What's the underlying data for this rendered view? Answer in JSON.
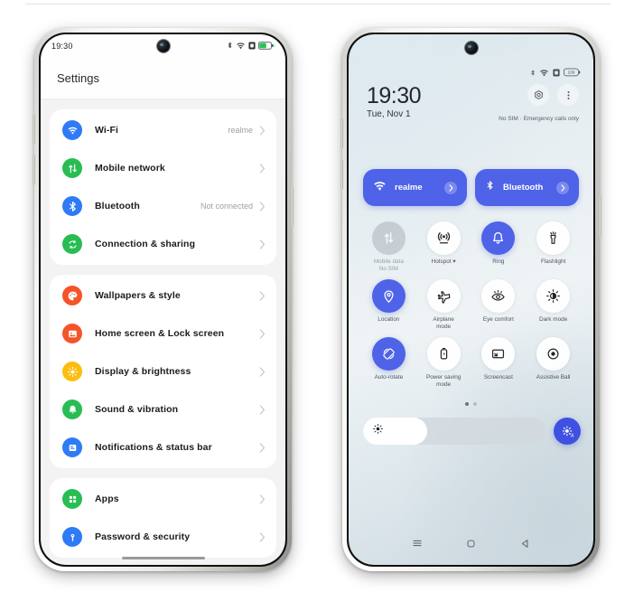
{
  "phone_settings": {
    "status_bar": {
      "time": "19:30",
      "icons": [
        "bluetooth-icon",
        "wifi-icon",
        "sim-card-icon",
        "battery-charging-icon"
      ]
    },
    "header_title": "Settings",
    "groups": [
      {
        "items": [
          {
            "label": "Wi-Fi",
            "value": "realme",
            "icon": "wifi-icon",
            "color": "#2f7bf6"
          },
          {
            "label": "Mobile network",
            "value": "",
            "icon": "mobile-network-icon",
            "color": "#28bd52"
          },
          {
            "label": "Bluetooth",
            "value": "Not connected",
            "icon": "bluetooth-icon",
            "color": "#2f7bf6"
          },
          {
            "label": "Connection & sharing",
            "value": "",
            "icon": "connection-sharing-icon",
            "color": "#28bd52"
          }
        ]
      },
      {
        "items": [
          {
            "label": "Wallpapers & style",
            "value": "",
            "icon": "wallpapers-icon",
            "color": "#f4542a"
          },
          {
            "label": "Home screen & Lock screen",
            "value": "",
            "icon": "home-lock-screen-icon",
            "color": "#f4542a"
          },
          {
            "label": "Display & brightness",
            "value": "",
            "icon": "display-brightness-icon",
            "color": "#fbbd10"
          },
          {
            "label": "Sound & vibration",
            "value": "",
            "icon": "sound-vibration-icon",
            "color": "#28bd52"
          },
          {
            "label": "Notifications & status bar",
            "value": "",
            "icon": "notifications-icon",
            "color": "#2f7bf6"
          }
        ]
      },
      {
        "items": [
          {
            "label": "Apps",
            "value": "",
            "icon": "apps-icon",
            "color": "#28bd52"
          },
          {
            "label": "Password & security",
            "value": "",
            "icon": "password-security-icon",
            "color": "#2f7bf6"
          }
        ]
      }
    ]
  },
  "phone_control_center": {
    "status_bar": {
      "icons": [
        "bluetooth-icon",
        "wifi-icon",
        "sim-card-icon",
        "battery-100-icon"
      ]
    },
    "clock": "19:30",
    "date": "Tue, Nov 1",
    "sim_status": "No SIM · Emergency calls only",
    "header_buttons": [
      "settings-gear-icon",
      "more-options-icon"
    ],
    "big_tiles": [
      {
        "label": "realme",
        "icon": "wifi-icon",
        "state": "on"
      },
      {
        "label": "Bluetooth",
        "icon": "bluetooth-icon",
        "state": "on"
      }
    ],
    "tiles": [
      {
        "label": "Mobile data\nNo SIM",
        "icon": "mobile-data-icon",
        "state": "disabled"
      },
      {
        "label": "Hotspot ▾",
        "icon": "hotspot-icon",
        "state": "off"
      },
      {
        "label": "Ring",
        "icon": "ring-bell-icon",
        "state": "on"
      },
      {
        "label": "Flashlight",
        "icon": "flashlight-icon",
        "state": "off"
      },
      {
        "label": "Location",
        "icon": "location-pin-icon",
        "state": "on"
      },
      {
        "label": "Airplane\nmode",
        "icon": "airplane-icon",
        "state": "off"
      },
      {
        "label": "Eye comfort",
        "icon": "eye-comfort-icon",
        "state": "off"
      },
      {
        "label": "Dark mode",
        "icon": "dark-mode-icon",
        "state": "off"
      },
      {
        "label": "Auto-rotate",
        "icon": "auto-rotate-icon",
        "state": "on"
      },
      {
        "label": "Power saving\nmode",
        "icon": "power-saving-icon",
        "state": "off"
      },
      {
        "label": "Screencast",
        "icon": "screencast-icon",
        "state": "off"
      },
      {
        "label": "Assistive Ball",
        "icon": "assistive-ball-icon",
        "state": "off"
      }
    ],
    "page_dots": {
      "count": 2,
      "active": 0
    },
    "brightness": {
      "value_percent": 35,
      "icon": "brightness-sun-icon",
      "auto_icon": "auto-brightness-icon"
    },
    "nav_bar": [
      "recents-icon",
      "home-icon",
      "back-icon"
    ]
  },
  "colors": {
    "accent_blue": "#4f63e8",
    "tile_on": "#4f63e8",
    "settings_card": "#ffffff",
    "settings_bg": "#f3f3f4"
  }
}
